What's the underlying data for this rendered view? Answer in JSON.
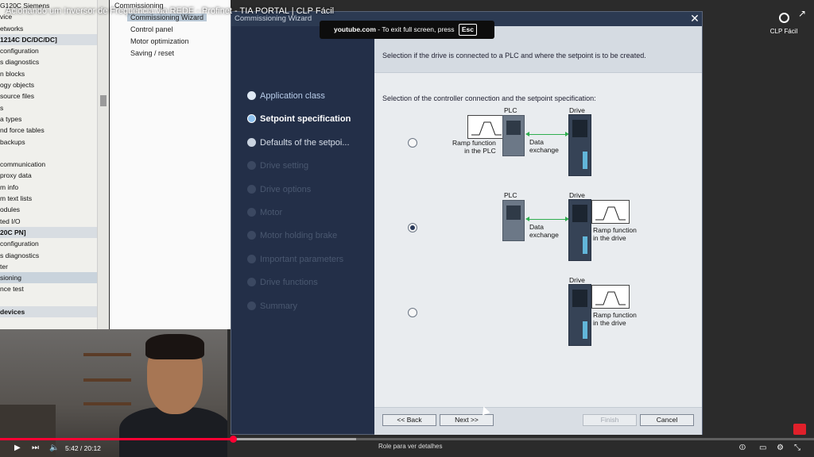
{
  "video": {
    "title": "Acionando um Inversor de Frequência via REDE - Profinet - TIA PORTAL | CLP Fácil",
    "channel_badge": "CLP Fácil",
    "fullscreen_toast": {
      "site": "youtube.com",
      "message": "- To exit full screen, press",
      "key": "Esc"
    },
    "time": "5:42 / 20:12",
    "scroll_hint": "Role para ver detalhes",
    "progress": 0.286
  },
  "project_tree": {
    "rows": [
      {
        "label": "G120C Siemens",
        "type": "normal"
      },
      {
        "label": "vice",
        "type": "normal"
      },
      {
        "label": "etworks",
        "type": "normal"
      },
      {
        "label": "1214C DC/DC/DC]",
        "type": "hdr"
      },
      {
        "label": "configuration",
        "type": "normal"
      },
      {
        "label": "s diagnostics",
        "type": "normal"
      },
      {
        "label": "n blocks",
        "type": "normal"
      },
      {
        "label": "ogy objects",
        "type": "normal"
      },
      {
        "label": "source files",
        "type": "normal"
      },
      {
        "label": "s",
        "type": "normal"
      },
      {
        "label": "a types",
        "type": "normal"
      },
      {
        "label": "nd force tables",
        "type": "normal"
      },
      {
        "label": "backups",
        "type": "normal"
      },
      {
        "label": "",
        "type": "normal"
      },
      {
        "label": "communication",
        "type": "normal"
      },
      {
        "label": "proxy data",
        "type": "normal"
      },
      {
        "label": "m info",
        "type": "normal"
      },
      {
        "label": "m text lists",
        "type": "normal"
      },
      {
        "label": "odules",
        "type": "normal"
      },
      {
        "label": "ted I/O",
        "type": "normal"
      },
      {
        "label": "20C PN]",
        "type": "hdr"
      },
      {
        "label": "configuration",
        "type": "normal"
      },
      {
        "label": "s diagnostics",
        "type": "normal"
      },
      {
        "label": "ter",
        "type": "normal"
      },
      {
        "label": "sioning",
        "type": "sel"
      },
      {
        "label": "nce test",
        "type": "normal"
      },
      {
        "label": "",
        "type": "normal"
      },
      {
        "label": "devices",
        "type": "hdr"
      }
    ]
  },
  "commissioning_nav": {
    "header": "Commissioning",
    "items": [
      "Commissioning Wizard",
      "Control panel",
      "Motor optimization",
      "Saving / reset"
    ]
  },
  "wizard": {
    "title": "Commissioning Wizard",
    "steps": [
      {
        "label": "Application class",
        "state": "done"
      },
      {
        "label": "Setpoint specification",
        "state": "active"
      },
      {
        "label": "Defaults of the setpoi...",
        "state": "next"
      },
      {
        "label": "Drive setting",
        "state": "off"
      },
      {
        "label": "Drive options",
        "state": "off"
      },
      {
        "label": "Motor",
        "state": "off"
      },
      {
        "label": "Motor holding brake",
        "state": "off"
      },
      {
        "label": "Important parameters",
        "state": "off"
      },
      {
        "label": "Drive functions",
        "state": "off"
      },
      {
        "label": "Summary",
        "state": "off"
      }
    ],
    "header_text": "Selection if the drive is connected to a PLC and where the setpoint is to be created.",
    "sub_text": "Selection of the controller connection and the setpoint specification:",
    "options": [
      {
        "selected": false,
        "plc_label": "PLC",
        "drive_label": "Drive",
        "ramp_label": "Ramp function\nin the PLC",
        "exchange_label": "Data\nexchange"
      },
      {
        "selected": true,
        "plc_label": "PLC",
        "drive_label": "Drive",
        "ramp_label": "Ramp function\nin the drive",
        "exchange_label": "Data\nexchange"
      },
      {
        "selected": false,
        "drive_label": "Drive",
        "ramp_label": "Ramp function\nin the drive"
      }
    ],
    "buttons": {
      "back": "<< Back",
      "next": "Next >>",
      "finish": "Finish",
      "cancel": "Cancel"
    }
  },
  "colors": {
    "accent_green": "#2fae4f",
    "wizard_dark": "#1f2b40",
    "yt_red": "#ff0033"
  }
}
